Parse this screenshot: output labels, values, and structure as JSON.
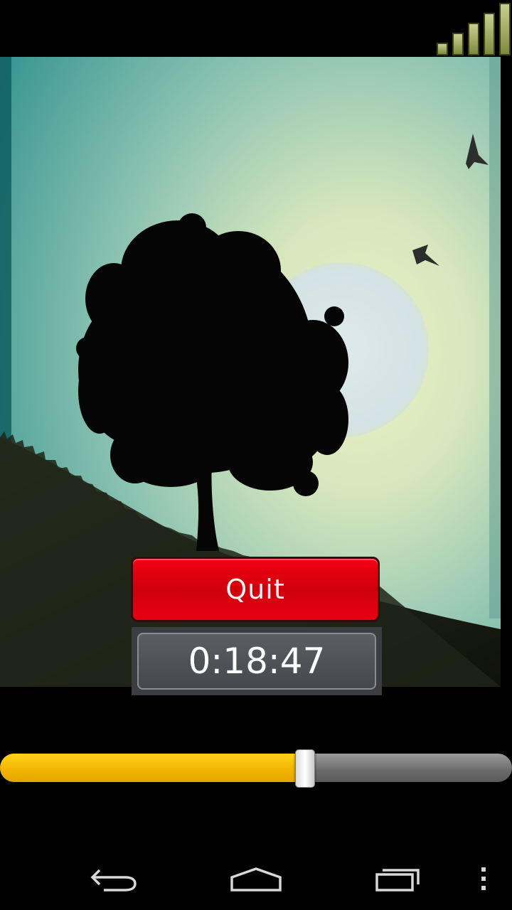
{
  "quit_label": "Quit",
  "timer_text": "0:18:47",
  "slider": {
    "value_fraction": 0.594
  },
  "signal": {
    "icon": "signal-strength-icon",
    "bars": 5
  },
  "colors": {
    "quit": "#e8000f",
    "slider_fill": "#ffc800",
    "signal": "#a9b35a"
  },
  "navbar": {
    "back_icon": "back-arrow-icon",
    "home_icon": "home-icon",
    "recents_icon": "recent-apps-icon",
    "menu_icon": "overflow-menu-icon"
  }
}
